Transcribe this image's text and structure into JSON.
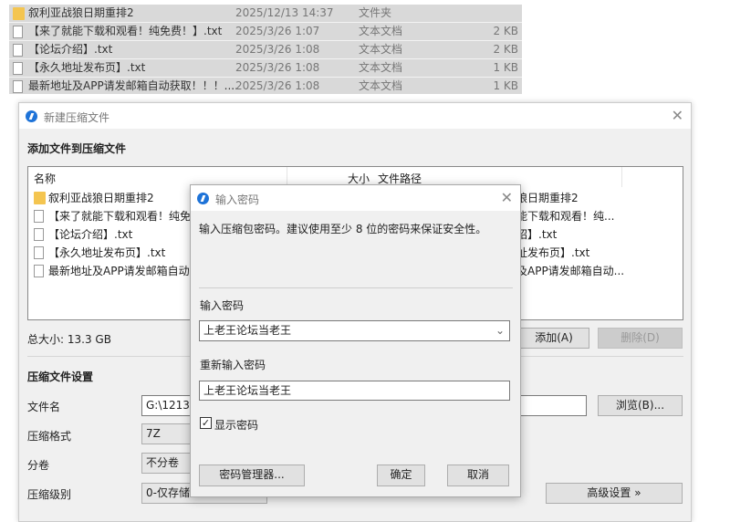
{
  "explorer": {
    "rows": [
      {
        "name": "叙利亚战狼日期重排2",
        "date": "2025/12/13 14:37",
        "type": "文件夹",
        "size": "",
        "icon": "folder-icon"
      },
      {
        "name": "【来了就能下载和观看！纯免费！】.txt",
        "date": "2025/3/26 1:07",
        "type": "文本文档",
        "size": "2 KB",
        "icon": "text-file-icon"
      },
      {
        "name": "【论坛介绍】.txt",
        "date": "2025/3/26 1:08",
        "type": "文本文档",
        "size": "2 KB",
        "icon": "text-file-icon"
      },
      {
        "name": "【永久地址发布页】.txt",
        "date": "2025/3/26 1:08",
        "type": "文本文档",
        "size": "1 KB",
        "icon": "text-file-icon"
      },
      {
        "name": "最新地址及APP请发邮箱自动获取！！！....",
        "date": "2025/3/26 1:08",
        "type": "文本文档",
        "size": "1 KB",
        "icon": "text-file-icon"
      }
    ]
  },
  "main": {
    "title": "新建压缩文件",
    "section_add": "添加文件到压缩文件",
    "columns": {
      "name": "名称",
      "size": "大小",
      "path": "文件路径"
    },
    "files": [
      {
        "name": "叙利亚战狼日期重排2",
        "path": "狼日期重排2"
      },
      {
        "name": "【来了就能下载和观看！纯免费",
        "path": "能下载和观看！纯..."
      },
      {
        "name": "【论坛介绍】.txt",
        "path": "绍】.txt"
      },
      {
        "name": "【永久地址发布页】.txt",
        "path": "址发布页】.txt"
      },
      {
        "name": "最新地址及APP请发邮箱自动获",
        "path": "及APP请发邮箱自动..."
      }
    ],
    "total_size": "总大小: 13.3 GB",
    "add_button": "添加(A)",
    "delete_button": "删除(D)",
    "section_settings": "压缩文件设置",
    "filename_label": "文件名",
    "filename_value": "G:\\1213\\叙",
    "browse_button": "浏览(B)...",
    "format_label": "压缩格式",
    "format_value": "7Z",
    "split_label": "分卷",
    "split_value": "不分卷",
    "level_label": "压缩级别",
    "level_value": "0-仅存储",
    "advanced_button": "高级设置 »"
  },
  "password_dialog": {
    "title": "输入密码",
    "hint": "输入压缩包密码。建议使用至少 8 位的密码来保证安全性。",
    "password_label": "输入密码",
    "password_value": "上老王论坛当老王",
    "confirm_label": "重新输入密码",
    "confirm_value": "上老王论坛当老王",
    "show_password": "显示密码",
    "show_password_checked": true,
    "manager_button": "密码管理器...",
    "ok_button": "确定",
    "cancel_button": "取消"
  }
}
